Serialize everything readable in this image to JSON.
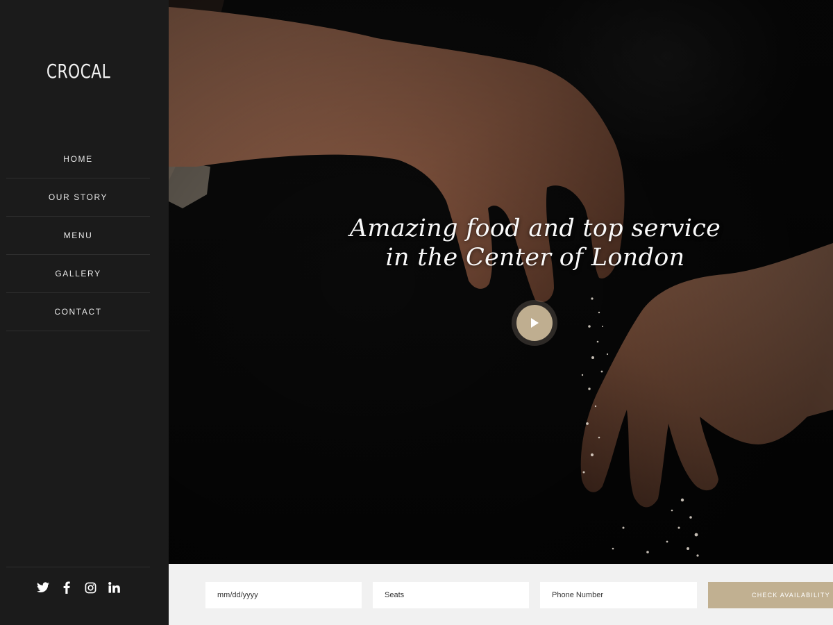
{
  "sidebar": {
    "logo": "CROCAL",
    "nav": [
      {
        "label": "HOME"
      },
      {
        "label": "OUR STORY"
      },
      {
        "label": "MENU"
      },
      {
        "label": "GALLERY"
      },
      {
        "label": "CONTACT"
      }
    ],
    "social": [
      "twitter-icon",
      "facebook-icon",
      "instagram-icon",
      "linkedin-icon"
    ]
  },
  "hero": {
    "title_line1": "Amazing food and top service",
    "title_line2": "in the Center of London",
    "play_icon": "play-icon"
  },
  "booking": {
    "date_placeholder": "mm/dd/yyyy",
    "seats_placeholder": "Seats",
    "phone_placeholder": "Phone Number",
    "check_label": "CHECK AVAILABILITY"
  },
  "colors": {
    "sidebar_bg": "#1b1b1b",
    "accent": "#c1b091",
    "booking_bg": "#f1f1f1"
  }
}
